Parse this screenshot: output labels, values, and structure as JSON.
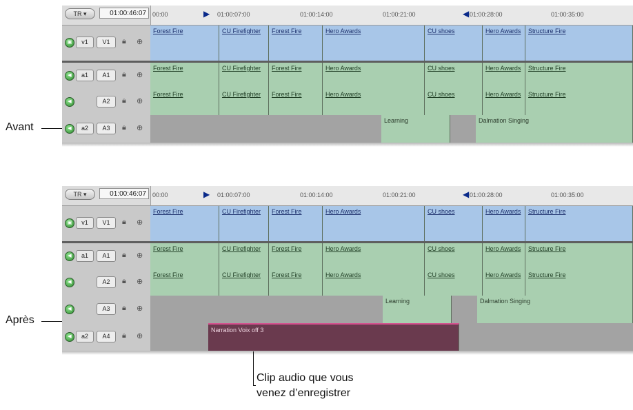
{
  "callouts": {
    "before": "Avant",
    "after": "Après"
  },
  "caption": {
    "line1": "Clip audio que vous",
    "line2": "venez d’enregistrer"
  },
  "ruler": {
    "tr_button": "TR ▾",
    "timecode": "01:00:46:07",
    "labels": [
      "00:00",
      "01:00:07:00",
      "01:00:14:00",
      "01:00:21:00",
      "01:00:28:00",
      "01:00:35:00"
    ]
  },
  "track_controls": {
    "v1_source": "v1",
    "a1_source": "a1",
    "a2_source": "a2",
    "V1": "V1",
    "A1": "A1",
    "A2": "A2",
    "A3": "A3",
    "A4": "A4"
  },
  "clips": {
    "forest_fire": "Forest Fire",
    "cu_firefighter": "CU Firefighter",
    "hero_awards": "Hero Awards",
    "cu_shoes": "CU shoes",
    "structure_fire": "Structure Fire",
    "learning": "Learning",
    "dalmation_singing": "Dalmation Singing",
    "narration": "Narration Voix off 3"
  },
  "colors": {
    "video_clip": "#a8c6e8",
    "audio_clip": "#a9cfb0",
    "recorded_clip": "#6a3a4e",
    "record_border": "#d4508e"
  }
}
